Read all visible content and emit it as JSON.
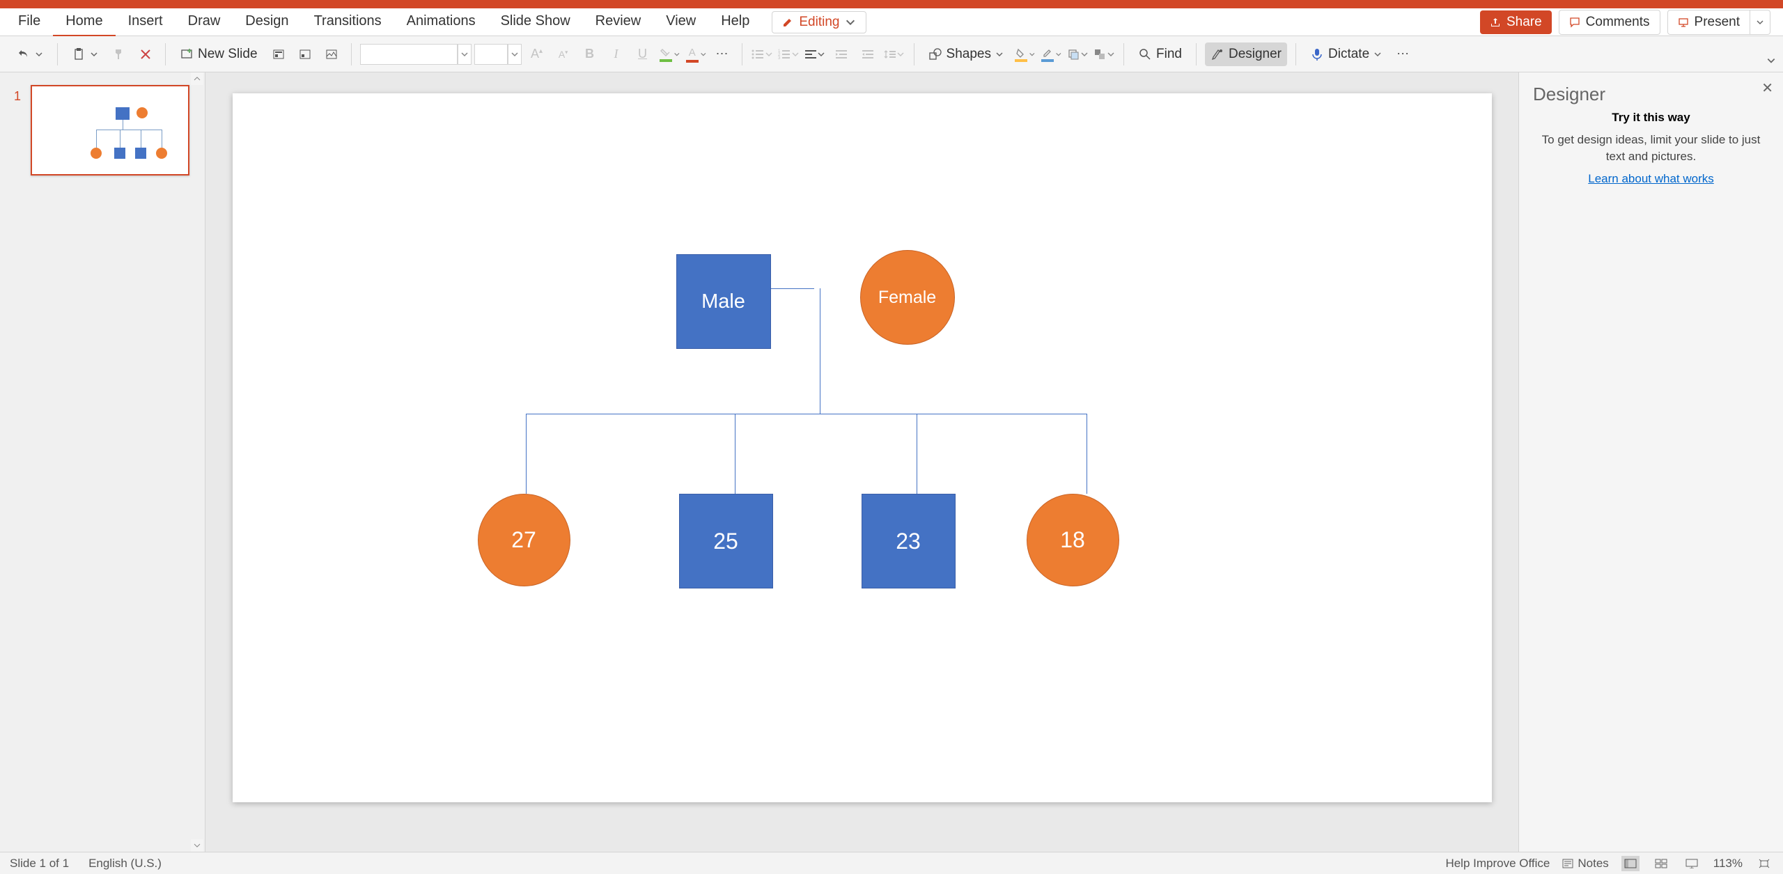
{
  "ribbon": {
    "tabs": [
      "File",
      "Home",
      "Insert",
      "Draw",
      "Design",
      "Transitions",
      "Animations",
      "Slide Show",
      "Review",
      "View",
      "Help"
    ],
    "active_tab": "Home",
    "editing_label": "Editing",
    "share_label": "Share",
    "comments_label": "Comments",
    "present_label": "Present"
  },
  "commands": {
    "new_slide": "New Slide",
    "shapes": "Shapes",
    "find": "Find",
    "designer": "Designer",
    "dictate": "Dictate"
  },
  "designer_pane": {
    "title": "Designer",
    "try_heading": "Try it this way",
    "body": "To get design ideas, limit your slide to just text and pictures.",
    "learn_link": "Learn about what works"
  },
  "slide_shapes": {
    "male": "Male",
    "female": "Female",
    "child1": "27",
    "child2": "25",
    "child3": "23",
    "child4": "18"
  },
  "thumbnail": {
    "number": "1"
  },
  "status": {
    "slide_info": "Slide 1 of 1",
    "language": "English (U.S.)",
    "help_improve": "Help Improve Office",
    "notes": "Notes",
    "zoom": "113%"
  }
}
